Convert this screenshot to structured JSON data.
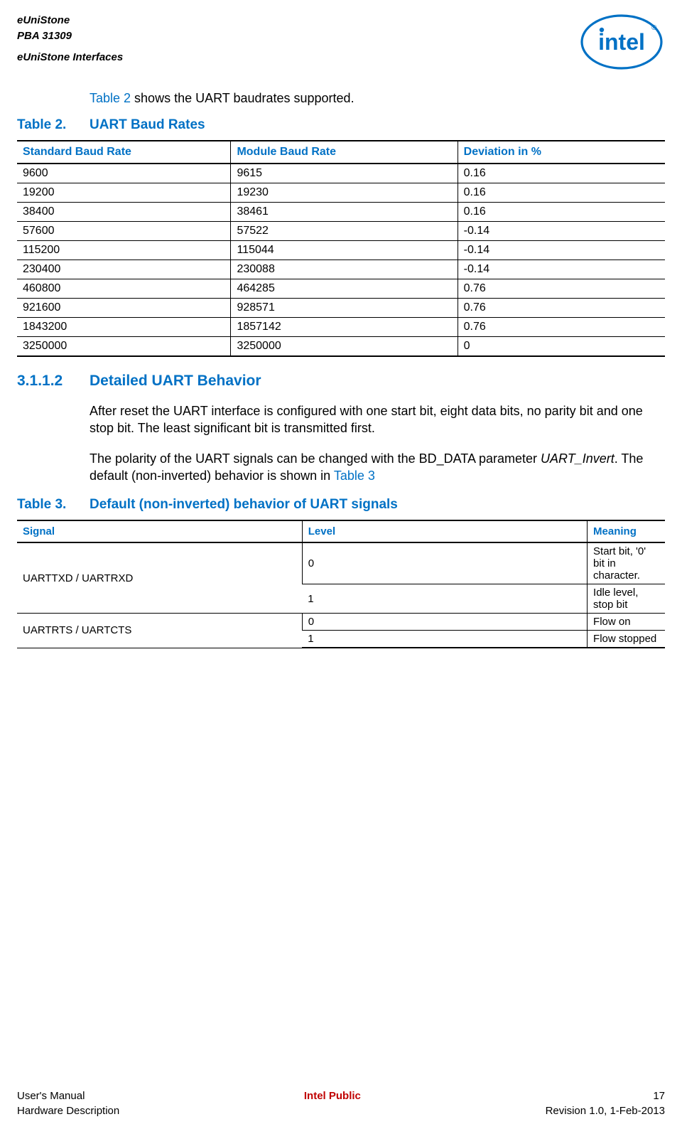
{
  "header": {
    "line1": "eUniStone",
    "line2": "PBA 31309",
    "line3": "eUniStone Interfaces"
  },
  "intro": {
    "link_text": "Table 2",
    "rest": " shows the UART baudrates supported."
  },
  "table2": {
    "caption_num": "Table 2.",
    "caption_title": "UART Baud Rates",
    "headers": [
      "Standard Baud Rate",
      "Module Baud Rate",
      "Deviation in %"
    ],
    "rows": [
      [
        "9600",
        "9615",
        "0.16"
      ],
      [
        "19200",
        "19230",
        "0.16"
      ],
      [
        "38400",
        "38461",
        "0.16"
      ],
      [
        "57600",
        "57522",
        "-0.14"
      ],
      [
        "115200",
        "115044",
        "-0.14"
      ],
      [
        "230400",
        "230088",
        "-0.14"
      ],
      [
        "460800",
        "464285",
        "0.76"
      ],
      [
        "921600",
        "928571",
        "0.76"
      ],
      [
        "1843200",
        "1857142",
        "0.76"
      ],
      [
        "3250000",
        "3250000",
        "0"
      ]
    ]
  },
  "section": {
    "num": "3.1.1.2",
    "title": "Detailed UART Behavior"
  },
  "para1": "After reset the UART interface is configured with one start bit, eight data bits, no parity bit and one stop bit. The least significant bit is transmitted first.",
  "para2_a": "The polarity of the UART signals can be changed with the BD_DATA parameter ",
  "para2_italic": "UART_Invert",
  "para2_b": ". The default (non-inverted) behavior is shown in ",
  "para2_link": "Table 3",
  "table3": {
    "caption_num": "Table 3.",
    "caption_title": "Default (non-inverted) behavior of UART signals",
    "headers": [
      "Signal",
      "Level",
      "Meaning"
    ],
    "rows": [
      [
        "UARTTXD / UARTRXD",
        "0",
        "Start bit, '0' bit in character."
      ],
      [
        "",
        "1",
        "Idle level, stop bit"
      ],
      [
        "UARTRTS / UARTCTS",
        "0",
        "Flow on"
      ],
      [
        "",
        "1",
        "Flow stopped"
      ]
    ]
  },
  "footer": {
    "left1": "User's Manual",
    "left2": "Hardware Description",
    "center": "Intel Public",
    "right1": "17",
    "right2": "Revision 1.0, 1-Feb-2013"
  }
}
